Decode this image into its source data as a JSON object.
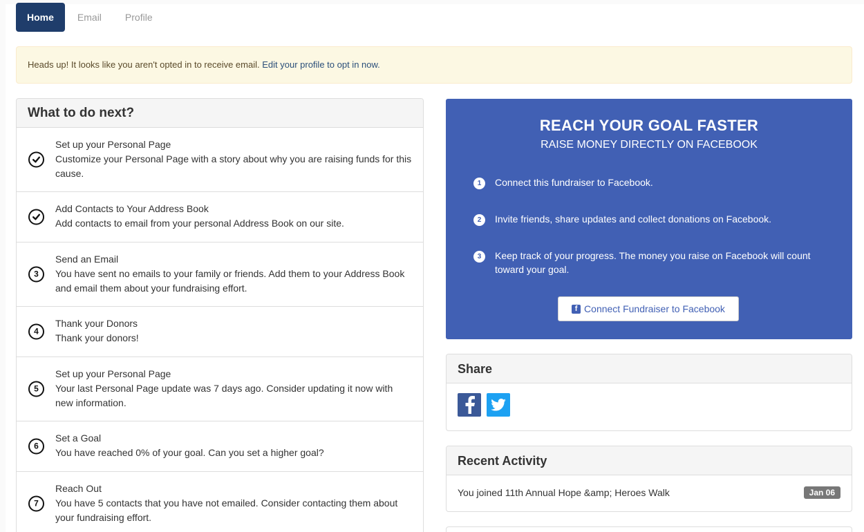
{
  "nav": {
    "tabs": [
      {
        "label": "Home",
        "active": true
      },
      {
        "label": "Email",
        "active": false
      },
      {
        "label": "Profile",
        "active": false
      }
    ]
  },
  "alert": {
    "text": "Heads up! It looks like you aren't opted in to receive email.",
    "link": "Edit your profile to opt in now."
  },
  "todo": {
    "title": "What to do next?",
    "items": [
      {
        "icon": "check",
        "title": "Set up your Personal Page",
        "desc": "Customize your Personal Page with a story about why you are raising funds for this cause."
      },
      {
        "icon": "check",
        "title": "Add Contacts to Your Address Book",
        "desc": "Add contacts to email from your personal Address Book on our site."
      },
      {
        "icon": "3",
        "title": "Send an Email",
        "desc": "You have sent no emails to your family or friends. Add them to your Address Book and email them about your fundraising effort."
      },
      {
        "icon": "4",
        "title": "Thank your Donors",
        "desc": "Thank your donors!"
      },
      {
        "icon": "5",
        "title": "Set up your Personal Page",
        "desc": "Your last Personal Page update was 7 days ago. Consider updating it now with new information."
      },
      {
        "icon": "6",
        "title": "Set a Goal",
        "desc": "You have reached 0% of your goal. Can you set a higher goal?"
      },
      {
        "icon": "7",
        "title": "Reach Out",
        "desc": "You have 5 contacts that you have not emailed. Consider contacting them about your fundraising effort."
      }
    ]
  },
  "facebook": {
    "title": "REACH YOUR GOAL FASTER",
    "subtitle": "RAISE MONEY DIRECTLY ON FACEBOOK",
    "steps": [
      {
        "num": "1",
        "text": "Connect this fundraiser to Facebook."
      },
      {
        "num": "2",
        "text": "Invite friends, share updates and collect donations on Facebook."
      },
      {
        "num": "3",
        "text": "Keep track of your progress. The money you raise on Facebook will count toward your goal."
      }
    ],
    "button": "Connect Fundraiser to Facebook",
    "color": "#4160b4"
  },
  "share": {
    "title": "Share",
    "icons": [
      "facebook-icon",
      "twitter-icon"
    ]
  },
  "activity": {
    "title": "Recent Activity",
    "items": [
      {
        "text": "You joined 11th Annual Hope &amp; Heroes Walk",
        "date": "Jan 06"
      }
    ]
  }
}
